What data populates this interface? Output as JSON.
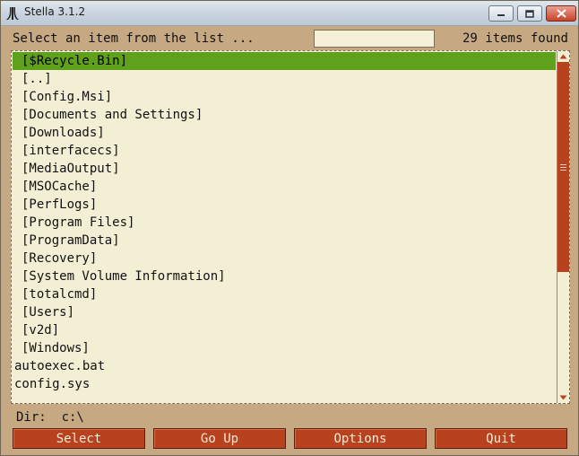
{
  "window": {
    "title": "Stella 3.1.2"
  },
  "header": {
    "prompt": "Select an item from the list ...",
    "filter_value": "",
    "count": "29 items found"
  },
  "list": {
    "selected_index": 0,
    "items": [
      {
        "label": "[$Recycle.Bin]",
        "kind": "dir"
      },
      {
        "label": "[..]",
        "kind": "dir"
      },
      {
        "label": "[Config.Msi]",
        "kind": "dir"
      },
      {
        "label": "[Documents and Settings]",
        "kind": "dir"
      },
      {
        "label": "[Downloads]",
        "kind": "dir"
      },
      {
        "label": "[interfacecs]",
        "kind": "dir"
      },
      {
        "label": "[MediaOutput]",
        "kind": "dir"
      },
      {
        "label": "[MSOCache]",
        "kind": "dir"
      },
      {
        "label": "[PerfLogs]",
        "kind": "dir"
      },
      {
        "label": "[Program Files]",
        "kind": "dir"
      },
      {
        "label": "[ProgramData]",
        "kind": "dir"
      },
      {
        "label": "[Recovery]",
        "kind": "dir"
      },
      {
        "label": "[System Volume Information]",
        "kind": "dir"
      },
      {
        "label": "[totalcmd]",
        "kind": "dir"
      },
      {
        "label": "[Users]",
        "kind": "dir"
      },
      {
        "label": "[v2d]",
        "kind": "dir"
      },
      {
        "label": "[Windows]",
        "kind": "dir"
      },
      {
        "label": "autoexec.bat",
        "kind": "file"
      },
      {
        "label": "config.sys",
        "kind": "file"
      }
    ]
  },
  "footer": {
    "dir_label": "Dir:  c:\\"
  },
  "buttons": {
    "select": "Select",
    "go_up": "Go Up",
    "options": "Options",
    "quit": "Quit"
  },
  "colors": {
    "background": "#c6a882",
    "list_background": "#f3efd5",
    "selection": "#5fa11a",
    "accent": "#b8421e"
  }
}
